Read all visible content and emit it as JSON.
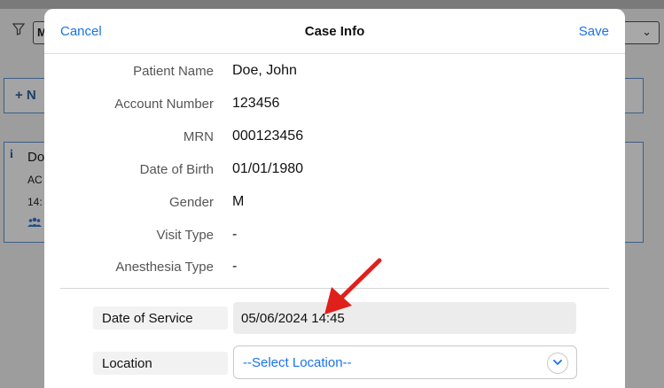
{
  "background": {
    "filter_icon": "filter-icon",
    "select_left_text": "M",
    "new_row_text": "+ N",
    "card": {
      "info_icon": "i",
      "name_partial": "Do",
      "line2_partial": "AC",
      "line3_partial": "14:",
      "group_icon": "group-icon"
    }
  },
  "modal": {
    "cancel_label": "Cancel",
    "title": "Case Info",
    "save_label": "Save",
    "info": [
      {
        "label": "Patient Name",
        "value": "Doe, John"
      },
      {
        "label": "Account Number",
        "value": "123456"
      },
      {
        "label": "MRN",
        "value": "000123456"
      },
      {
        "label": "Date of Birth",
        "value": "01/01/1980"
      },
      {
        "label": "Gender",
        "value": "M"
      },
      {
        "label": "Visit Type",
        "value": "-"
      },
      {
        "label": "Anesthesia Type",
        "value": "-"
      }
    ],
    "date_of_service": {
      "label": "Date of Service",
      "value": "05/06/2024 14:45"
    },
    "location": {
      "label": "Location",
      "placeholder": "--Select Location--"
    }
  },
  "colors": {
    "accent": "#1a73e8",
    "arrow": "#e0201b"
  }
}
